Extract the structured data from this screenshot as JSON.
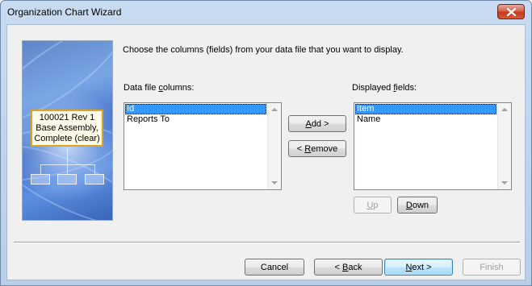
{
  "window": {
    "title": "Organization Chart Wizard"
  },
  "side_image": {
    "card_line1": "100021 Rev 1",
    "card_line2": "Base Assembly,",
    "card_line3": "Complete (clear)"
  },
  "instruction": "Choose the columns (fields) from your data file that you want to display.",
  "data_file_columns": {
    "label_pre": "Data file ",
    "label_u": "c",
    "label_post": "olumns:",
    "items": [
      "Id",
      "Reports To"
    ],
    "selected_index": 0
  },
  "displayed_fields": {
    "label_pre": "Displayed ",
    "label_u": "f",
    "label_post": "ields:",
    "items": [
      "Item",
      "Name"
    ],
    "selected_index": 0
  },
  "buttons": {
    "add_u": "A",
    "add_rest": "dd >",
    "remove_pre": "< ",
    "remove_u": "R",
    "remove_rest": "emove",
    "up_u": "U",
    "up_rest": "p",
    "down_u": "D",
    "down_rest": "own",
    "cancel": "Cancel",
    "back_pre": "< ",
    "back_u": "B",
    "back_rest": "ack",
    "next_u": "N",
    "next_rest": "ext >",
    "finish": "Finish"
  },
  "colors": {
    "selection": "#3399ff",
    "title_bar": "#c9dbf0",
    "card_border": "#e0a421"
  },
  "icons": {
    "close": "close-icon"
  }
}
